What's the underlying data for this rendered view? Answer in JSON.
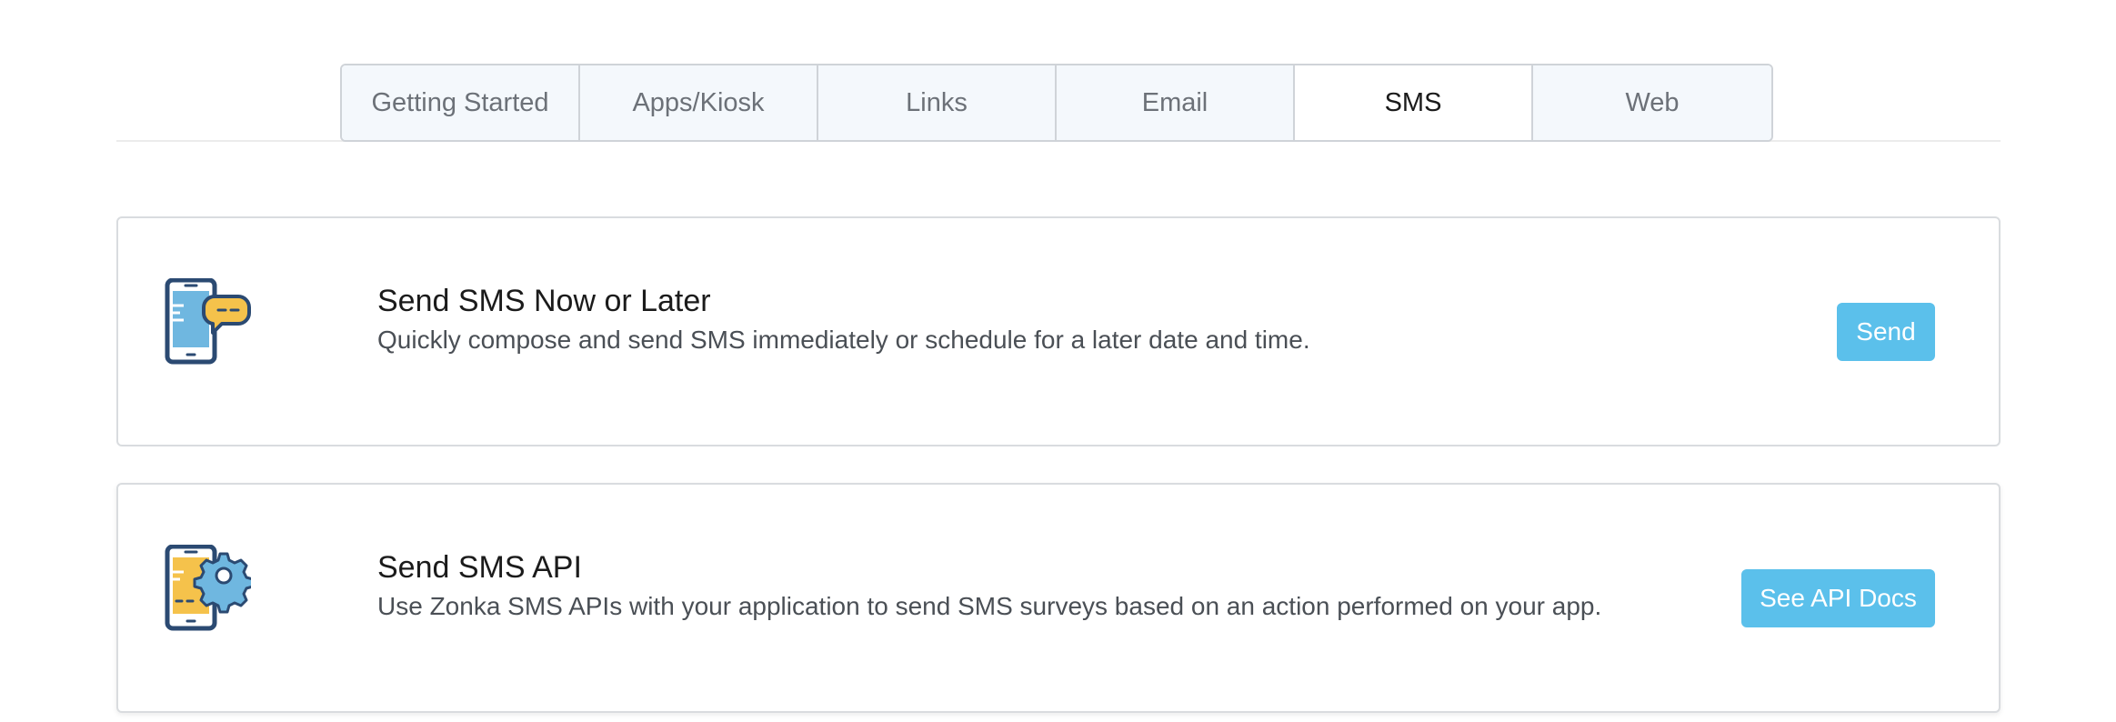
{
  "tabs": [
    {
      "label": "Getting Started",
      "active": false
    },
    {
      "label": "Apps/Kiosk",
      "active": false
    },
    {
      "label": "Links",
      "active": false
    },
    {
      "label": "Email",
      "active": false
    },
    {
      "label": "SMS",
      "active": true
    },
    {
      "label": "Web",
      "active": false
    }
  ],
  "cards": [
    {
      "icon": "phone-chat-icon",
      "title": "Send SMS Now or Later",
      "description": "Quickly compose and send SMS immediately or schedule for a later date and time.",
      "button_label": "Send"
    },
    {
      "icon": "phone-gear-icon",
      "title": "Send SMS API",
      "description": "Use Zonka SMS APIs with your application to send SMS surveys based on an action performed on your app.",
      "button_label": "See API Docs"
    }
  ],
  "colors": {
    "accent": "#5bc0eb",
    "icon_navy": "#2b4a72",
    "icon_blue": "#6fb7e0",
    "icon_yellow": "#f5c24b"
  }
}
